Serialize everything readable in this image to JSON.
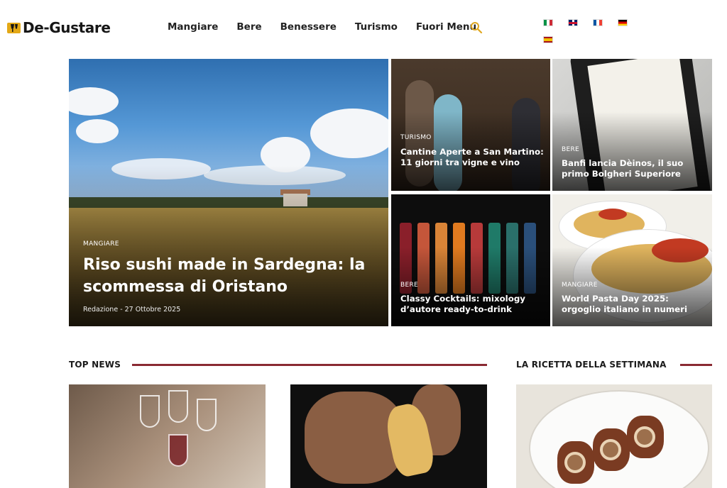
{
  "header": {
    "logo_text": "De-Gustare",
    "nav": [
      "Mangiare",
      "Bere",
      "Benessere",
      "Turismo",
      "Fuori Menu"
    ],
    "languages": [
      "it",
      "en",
      "fr",
      "de",
      "es"
    ]
  },
  "hero": {
    "main": {
      "category": "MANGIARE",
      "title": "Riso sushi made in Sardegna: la scommessa di Oristano",
      "meta": "Redazione  -  27 Ottobre 2025"
    },
    "cards": [
      {
        "category": "TURISMO",
        "title": "Cantine Aperte a San Martino: 11 giorni tra vigne e vino"
      },
      {
        "category": "BERE",
        "title": "Banfi lancia Dèinos, il suo primo Bolgheri Superiore"
      },
      {
        "category": "BERE",
        "title": "Classy Cocktails: mixology d’autore ready-to-drink"
      },
      {
        "category": "MANGIARE",
        "title": "World Pasta Day 2025: orgoglio italiano in numeri"
      }
    ]
  },
  "sections": {
    "top_news": "TOP NEWS",
    "recipe": "LA RICETTA DELLA SETTIMANA"
  },
  "colors": {
    "accent_line": "#8a2a33",
    "logo_gold": "#e3a816",
    "search_icon": "#e0a820"
  }
}
